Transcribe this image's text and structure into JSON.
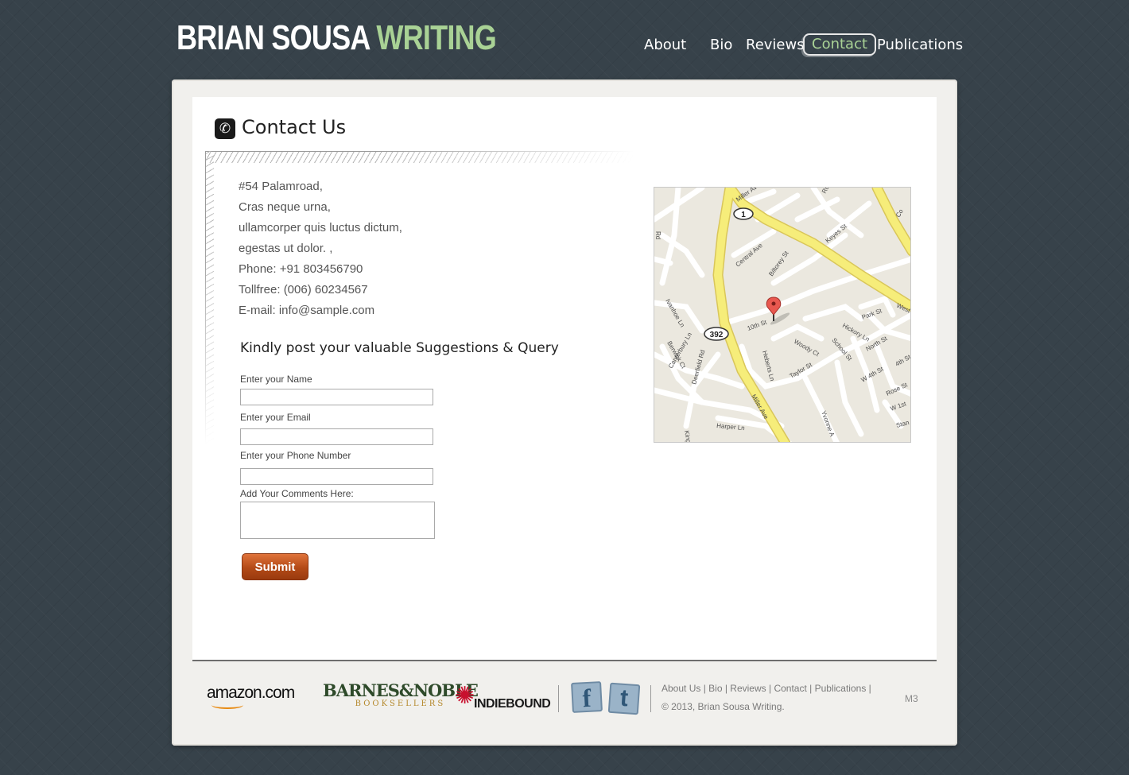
{
  "brand": {
    "part1": "BRIAN SOUSA",
    "part2": "WRITING"
  },
  "nav": {
    "items": [
      {
        "label": "About"
      },
      {
        "label": "Bio"
      },
      {
        "label": "Reviews"
      },
      {
        "label": "Contact",
        "active": true
      },
      {
        "label": "Publications"
      }
    ]
  },
  "section": {
    "icon": "phone-icon",
    "title": "Contact Us"
  },
  "address": {
    "lines": [
      "#54 Palamroad,",
      "Cras neque urna,",
      "ullamcorper quis luctus dictum,",
      "egestas ut dolor. ,",
      "Phone: +91 803456790",
      "Tollfree: (006) 60234567",
      "E-mail: info@sample.com"
    ]
  },
  "form": {
    "title": "Kindly post your valuable Suggestions &  Query",
    "name_label": "Enter your Name",
    "email_label": "Enter your Email",
    "phone_label": "Enter your Phone Number",
    "comments_label": "Add Your Comments Here:",
    "name_value": "",
    "email_value": "",
    "phone_value": "",
    "comments_value": "",
    "submit_label": "Submit"
  },
  "map": {
    "streets": [
      "Miller Ave",
      "Central Ave",
      "Biltorey St",
      "Keyes St",
      "Ivanhoe Ln",
      "10th St",
      "Park St",
      "Hickory Ln",
      "Woody Ct",
      "School St",
      "North St",
      "Berwick Ct",
      "Canterbury Ln",
      "Deerfield Rd",
      "Heberts Ln",
      "Taylor St",
      "W 4th St",
      "4th St",
      "Rose St",
      "W 1st",
      "Stan",
      "Harper Ln",
      "Yvonne A",
      "King",
      "Miller Ave",
      "West",
      "Co",
      "Rd",
      "Rd"
    ],
    "route_1": "1",
    "route_392": "392",
    "marker_icon": "map-pin-icon"
  },
  "footer": {
    "partners": {
      "amazon": "amazon.com",
      "bn_top": "BARNES&NOBLE",
      "bn_bottom": "BOOKSELLERS",
      "indie": "INDIEBOUND"
    },
    "social": {
      "facebook": "f",
      "twitter": "t"
    },
    "links": [
      "About Us",
      "Bio",
      "Reviews",
      "Contact",
      "Publications"
    ],
    "copyright": "© 2013, Brian Sousa Writing.",
    "code": "M3"
  },
  "colors": {
    "background": "#37424a",
    "accent": "#a9d295",
    "submit": "#c2541d"
  }
}
